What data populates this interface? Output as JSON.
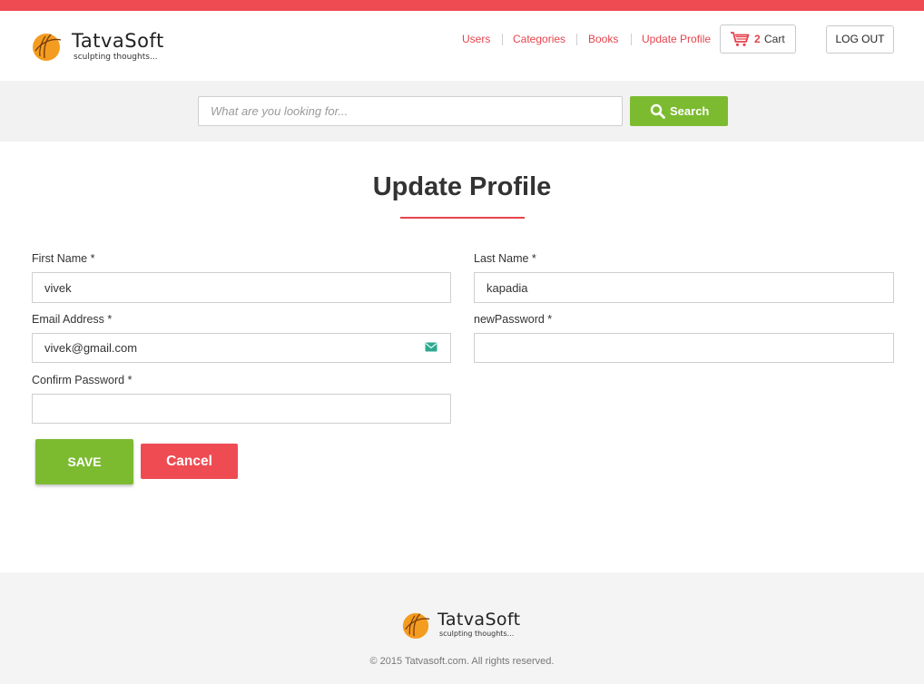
{
  "brand": {
    "name": "TatvaSoft",
    "tagline": "sculpting thoughts..."
  },
  "nav": {
    "items": [
      {
        "label": "Users"
      },
      {
        "label": "Categories"
      },
      {
        "label": "Books"
      },
      {
        "label": "Update Profile"
      }
    ],
    "cart": {
      "count": "2",
      "label": "Cart",
      "icon": "cart-icon"
    },
    "logout_label": "LOG OUT"
  },
  "search": {
    "placeholder": "What are you looking for...",
    "button_label": "Search",
    "icon": "search-icon"
  },
  "page": {
    "title": "Update Profile"
  },
  "form": {
    "first_name": {
      "label": "First Name *",
      "value": "vivek"
    },
    "last_name": {
      "label": "Last Name *",
      "value": "kapadia"
    },
    "email": {
      "label": "Email Address *",
      "value": "vivek@gmail.com",
      "icon": "mail-icon"
    },
    "new_password": {
      "label": "newPassword *",
      "value": ""
    },
    "confirm_password": {
      "label": "Confirm Password *",
      "value": ""
    },
    "save_label": "SAVE",
    "cancel_label": "Cancel"
  },
  "footer": {
    "copyright": "© 2015 Tatvasoft.com. All rights reserved."
  },
  "colors": {
    "accent_red": "#ee4b52",
    "accent_green": "#7cbb30",
    "link_red": "#e6434c"
  }
}
